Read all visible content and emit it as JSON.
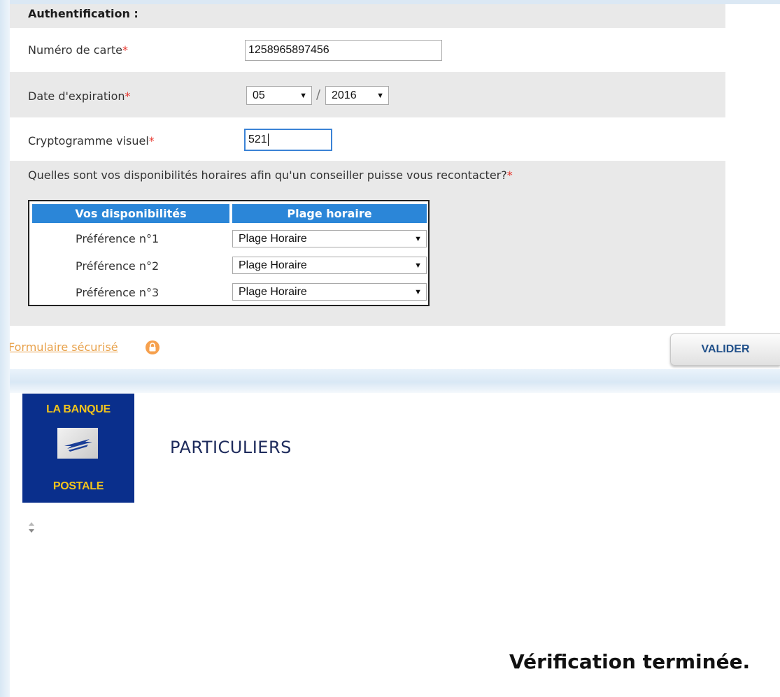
{
  "form": {
    "title": "Authentification :",
    "card_number": {
      "label": "Numéro de carte",
      "value": "1258965897456"
    },
    "expiration": {
      "label": "Date d'expiration",
      "month": "05",
      "year": "2016",
      "separator": "/"
    },
    "cvv": {
      "label": "Cryptogramme visuel",
      "value": "521"
    },
    "required_mark": "*",
    "question": "Quelles sont vos disponibilités horaires afin qu'un conseiller puisse vous recontacter?",
    "table": {
      "headers": [
        "Vos disponibilités",
        "Plage horaire"
      ],
      "rows": [
        {
          "label": "Préférence n°1",
          "value": "Plage Horaire"
        },
        {
          "label": "Préférence n°2",
          "value": "Plage Horaire"
        },
        {
          "label": "Préférence n°3",
          "value": "Plage Horaire"
        }
      ]
    }
  },
  "footer": {
    "secure_link": "Formulaire sécurisé",
    "submit": "VALIDER"
  },
  "logo": {
    "line1": "LA BANQUE",
    "line2": "POSTALE"
  },
  "section_title": "PARTICULIERS",
  "status": "Vérification terminée.",
  "colors": {
    "accent": "#2b86d8",
    "required": "#e8382f",
    "link": "#e8a14a",
    "logo_bg": "#0a2f8c",
    "logo_text": "#f2c41b"
  }
}
